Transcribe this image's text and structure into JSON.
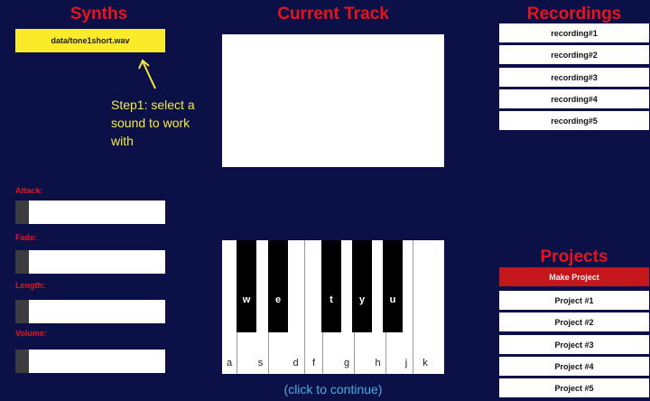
{
  "synths": {
    "heading": "Synths",
    "selected_sound": "data/tone1short.wav",
    "hint": "Step1: select a sound to work with",
    "params": [
      {
        "label": "Attack:",
        "level": 0
      },
      {
        "label": "Fade:",
        "level": 0
      },
      {
        "label": "Length:",
        "level": 0
      },
      {
        "label": "Volume:",
        "level": 0
      }
    ]
  },
  "track": {
    "heading": "Current Track",
    "white_keys": [
      "a",
      "s",
      "d",
      "f",
      "g",
      "h",
      "j",
      "k"
    ],
    "black_keys": [
      "w",
      "e",
      "t",
      "y",
      "u"
    ],
    "continue_label": "(click to continue)"
  },
  "recordings": {
    "heading": "Recordings",
    "items": [
      "recording#1",
      "recording#2",
      "recording#3",
      "recording#4",
      "recording#5"
    ]
  },
  "projects": {
    "heading": "Projects",
    "new_label": "Make Project",
    "items": [
      "Project #1",
      "Project #2",
      "Project #3",
      "Project #4",
      "Project #5"
    ]
  },
  "colors": {
    "background": "#0b1147",
    "heading_red": "#e8131b",
    "selected_yellow": "#f9ea2a",
    "hint_yellow": "#f6e84a",
    "link_blue": "#45aee6"
  }
}
